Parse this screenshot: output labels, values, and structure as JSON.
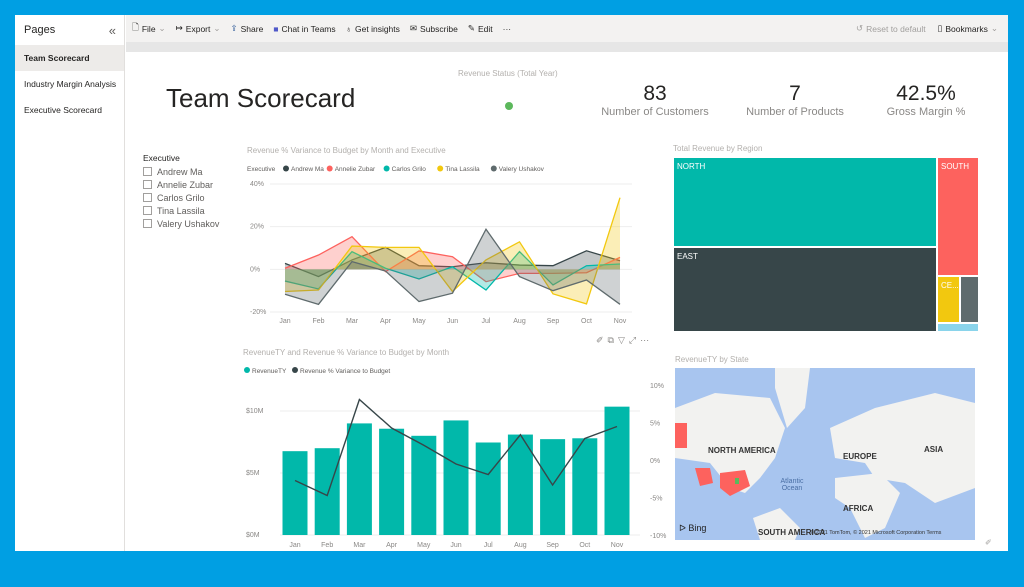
{
  "sidebar": {
    "title": "Pages",
    "collapse_icon": "double-chevron-left",
    "pages": [
      {
        "label": "Team Scorecard",
        "active": true
      },
      {
        "label": "Industry Margin Analysis"
      },
      {
        "label": "Executive Scorecard"
      }
    ]
  },
  "toolbar": {
    "file": "File",
    "export": "Export",
    "share": "Share",
    "chat": "Chat in Teams",
    "insights": "Get insights",
    "subscribe": "Subscribe",
    "edit": "Edit",
    "more": "···",
    "reset": "Reset to default",
    "bookmarks": "Bookmarks"
  },
  "report": {
    "title": "Team Scorecard",
    "status": {
      "title": "Revenue Status (Total Year)",
      "color": "#5cb85c"
    },
    "kpis": [
      {
        "value": "83",
        "label": "Number of Customers"
      },
      {
        "value": "7",
        "label": "Number of Products"
      },
      {
        "value": "42.5%",
        "label": "Gross Margin %"
      }
    ],
    "slicer": {
      "title": "Executive",
      "items": [
        "Andrew Ma",
        "Annelie Zubar",
        "Carlos Grilo",
        "Tina Lassila",
        "Valery Ushakov"
      ]
    },
    "treemap_title": "Total Revenue by Region",
    "treemap": [
      {
        "label": "NORTH",
        "color": "#01b8aa"
      },
      {
        "label": "EAST",
        "color": "#374649"
      },
      {
        "label": "SOUTH",
        "color": "#fd625e"
      },
      {
        "label": "CE...",
        "color": "#f2c80f"
      },
      {
        "label": "",
        "color": "#5f6b6d"
      },
      {
        "label": "",
        "color": "#8ad4eb"
      }
    ],
    "map": {
      "title": "RevenueTY by State",
      "labels": [
        "NORTH AMERICA",
        "EUROPE",
        "ASIA",
        "AFRICA",
        "SOUTH AMERICA",
        "Atlantic Ocean"
      ],
      "bing": "Bing",
      "copyright": "© 2021 TomTom, © 2021 Microsoft Corporation  Terms"
    }
  },
  "chart_data": [
    {
      "type": "area",
      "title": "Revenue % Variance to Budget by Month and Executive",
      "legend_title": "Executive",
      "legend_position": "top-left",
      "categories": [
        "Jan",
        "Feb",
        "Mar",
        "Apr",
        "May",
        "Jun",
        "Jul",
        "Aug",
        "Sep",
        "Oct",
        "Nov"
      ],
      "ylim": [
        -20,
        40
      ],
      "yticks": [
        "40%",
        "20%",
        "0%",
        "-20%"
      ],
      "grid": true,
      "series": [
        {
          "name": "Andrew Ma",
          "color": "#374649",
          "values": [
            2.8,
            -3.4,
            4.4,
            10.3,
            1.7,
            1.2,
            3.1,
            2.0,
            1.7,
            8.7,
            4.0
          ]
        },
        {
          "name": "Annelie Zubar",
          "color": "#fd625e",
          "values": [
            0.5,
            6.7,
            15.3,
            -1.1,
            8.6,
            5.9,
            -5.8,
            -1.9,
            -1.9,
            -1.6,
            5.6
          ]
        },
        {
          "name": "Carlos Grilo",
          "color": "#01b8aa",
          "values": [
            -5.5,
            -9.2,
            8.3,
            0.5,
            -4.5,
            1.2,
            -9.7,
            8.3,
            -7.3,
            1.7,
            2.5
          ]
        },
        {
          "name": "Tina Lassila",
          "color": "#f2c80f",
          "values": [
            -10.4,
            -9.7,
            10.9,
            10.3,
            10.3,
            -10.4,
            4.4,
            12.9,
            -11.5,
            -16.2,
            33.6
          ]
        },
        {
          "name": "Valery Ushakov",
          "color": "#5f6b6d",
          "values": [
            -11.7,
            -16.4,
            3.6,
            -0.8,
            -15.1,
            -11.2,
            18.8,
            -3.4,
            -10.0,
            -5.0,
            -16.4
          ]
        }
      ]
    },
    {
      "type": "bar",
      "title": "RevenueTY and Revenue % Variance to Budget by Month",
      "legend_position": "top-left",
      "categories": [
        "Jan",
        "Feb",
        "Mar",
        "Apr",
        "May",
        "Jun",
        "Jul",
        "Aug",
        "Sep",
        "Oct",
        "Nov"
      ],
      "ylim": [
        0,
        11.5
      ],
      "yticks": [
        "$10M",
        "$5M",
        "$0M"
      ],
      "y2lim": [
        -10,
        10
      ],
      "y2ticks": [
        "10%",
        "5%",
        "0%",
        "-5%",
        "-10%"
      ],
      "series": [
        {
          "name": "RevenueTY",
          "color": "#01b8aa",
          "unit": "$M",
          "values": [
            6.76,
            7.0,
            9.0,
            8.57,
            8.0,
            9.24,
            7.46,
            8.1,
            7.73,
            7.8,
            10.35
          ]
        },
        {
          "name": "Revenue % Variance to Budget",
          "color": "#374649",
          "type": "line",
          "axis": "right",
          "unit": "%",
          "values": [
            -2.6,
            -4.6,
            8.2,
            4.4,
            2.1,
            -0.4,
            -1.8,
            3.5,
            -3.2,
            3.0,
            4.6
          ]
        }
      ]
    }
  ]
}
